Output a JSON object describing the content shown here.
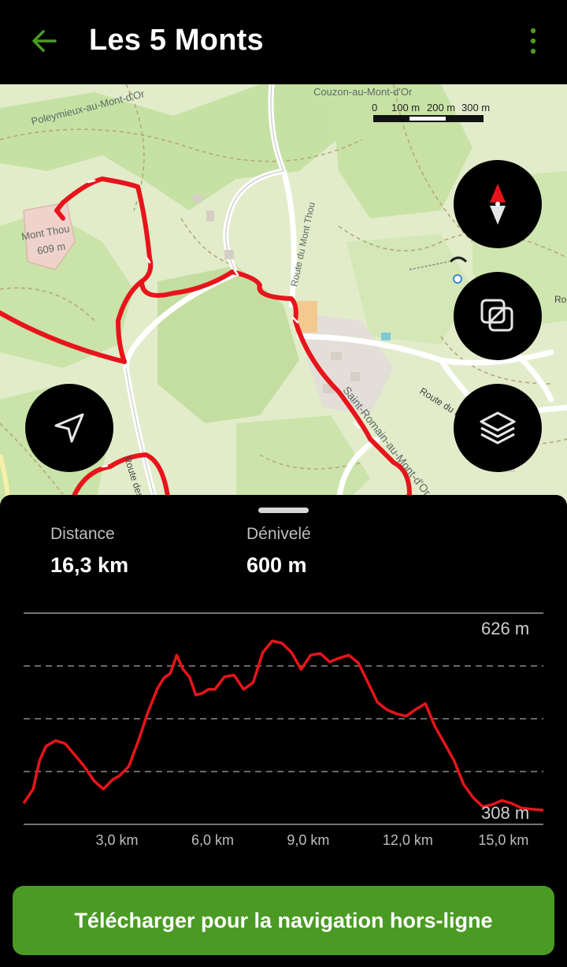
{
  "header": {
    "title": "Les 5 Monts",
    "back_icon": "arrow-left-icon",
    "menu_icon": "more-vertical-icon",
    "accent_color": "#4a9a24"
  },
  "map": {
    "labels": {
      "couzon": "Couzon-au-Mont-d'Or",
      "poleymieux": "Poleymieux-au-Mont-d'Or",
      "mont_thou": "Mont Thou",
      "mont_thou_alt": "609 m",
      "route_mont_thou": "Route du Mont Thou",
      "saint_romain": "Saint-Romain-au-Mont-d'Or",
      "route_du_m": "Route du M",
      "route_des_cr": "Route des Crê",
      "ro": "Ro"
    },
    "scale": {
      "zero": "0",
      "l100": "100 m",
      "l200": "200 m",
      "l300": "300 m"
    },
    "route_color": "#e8141b",
    "buttons": {
      "compass_icon": "compass-icon",
      "layers_toggle_icon": "overlay-toggle-icon",
      "locate_icon": "navigation-arrow-icon",
      "map_layers_icon": "layers-icon"
    }
  },
  "stats": {
    "distance_label": "Distance",
    "distance_value": "16,3 km",
    "elevation_label": "Dénivelé",
    "elevation_value": "600 m"
  },
  "chart_data": {
    "type": "area",
    "x_ticks": [
      "3,0 km",
      "6,0 km",
      "9,0 km",
      "12,0 km",
      "15,0 km"
    ],
    "max_label": "626 m",
    "min_label": "308 m",
    "xlabel": "",
    "ylabel": "",
    "ylim": [
      308,
      626
    ],
    "xlim": [
      0,
      16.3
    ],
    "grid": true,
    "series": [
      {
        "x": [
          0.0,
          0.3,
          0.5,
          0.7,
          1.0,
          1.3,
          1.6,
          1.9,
          2.2,
          2.5,
          2.8,
          3.0,
          3.3,
          3.6,
          3.9,
          4.2,
          4.4,
          4.6,
          4.8,
          5.0,
          5.2,
          5.4,
          5.6,
          5.8,
          6.0,
          6.3,
          6.6,
          6.9,
          7.2,
          7.5,
          7.8,
          8.1,
          8.4,
          8.7,
          9.0,
          9.3,
          9.6,
          9.9,
          10.2,
          10.5,
          10.8,
          11.1,
          11.4,
          11.7,
          12.0,
          12.3,
          12.6,
          12.9,
          13.2,
          13.5,
          13.8,
          14.1,
          14.4,
          14.7,
          15.0,
          15.3,
          15.6,
          15.9,
          16.3
        ],
        "y": [
          320,
          345,
          395,
          420,
          430,
          425,
          405,
          385,
          360,
          345,
          362,
          368,
          385,
          430,
          480,
          522,
          540,
          548,
          580,
          555,
          542,
          510,
          513,
          520,
          520,
          542,
          545,
          520,
          532,
          585,
          605,
          601,
          585,
          555,
          580,
          583,
          568,
          575,
          580,
          566,
          532,
          497,
          484,
          477,
          473,
          485,
          495,
          455,
          425,
          395,
          353,
          330,
          314,
          318,
          325,
          320,
          312,
          310,
          308
        ]
      }
    ]
  },
  "cta": {
    "label": "Télécharger pour la navigation hors-ligne"
  }
}
